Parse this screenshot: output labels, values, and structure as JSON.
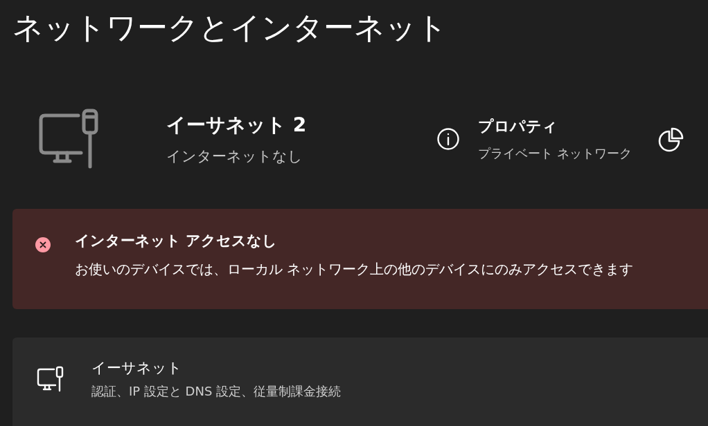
{
  "page_title": "ネットワークとインターネット",
  "connection": {
    "name": "イーサネット 2",
    "status": "インターネットなし"
  },
  "properties": {
    "title": "プロパティ",
    "subtitle": "プライベート ネットワーク"
  },
  "alert": {
    "kind": "error",
    "title": "インターネット アクセスなし",
    "message": "お使いのデバイスでは、ローカル ネットワーク上の他のデバイスにのみアクセスできます"
  },
  "settings_items": [
    {
      "title": "イーサネット",
      "subtitle": "認証、IP 設定と DNS 設定、従量制課金接続"
    }
  ]
}
